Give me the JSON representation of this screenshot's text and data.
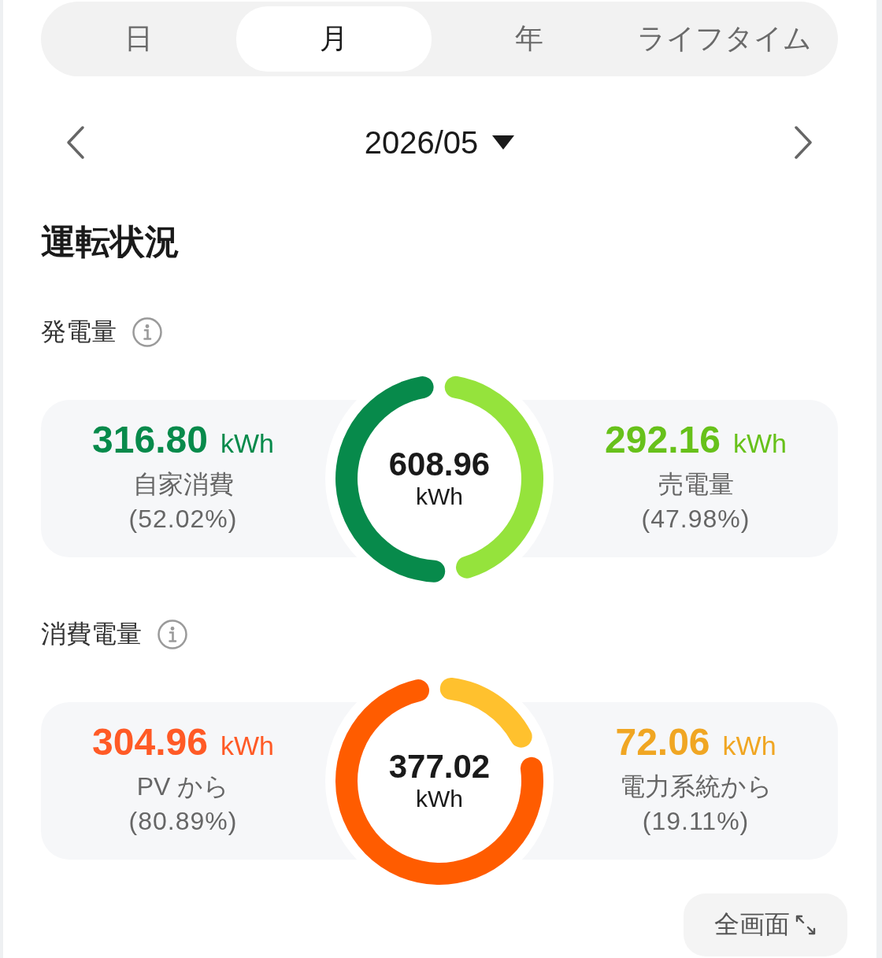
{
  "tabs": [
    {
      "label": "日",
      "selected": false
    },
    {
      "label": "月",
      "selected": true
    },
    {
      "label": "年",
      "selected": false
    },
    {
      "label": "ライフタイム",
      "selected": false
    }
  ],
  "period": {
    "label": "2026/05"
  },
  "section_title": "運転状況",
  "panels": [
    {
      "title": "発電量",
      "total": {
        "value": "608.96",
        "unit": "kWh"
      },
      "items": [
        {
          "value": "316.80",
          "unit": "kWh",
          "label": "自家消費",
          "share": "(52.02%)",
          "color": "#078a4b"
        },
        {
          "value": "292.16",
          "unit": "kWh",
          "label": "売電量",
          "share": "(47.98%)",
          "color": "#67c11a"
        }
      ],
      "chart_data": {
        "type": "donut",
        "values": [
          52.02,
          47.98
        ],
        "colors": [
          "#078a4b",
          "#95e33c"
        ]
      }
    },
    {
      "title": "消費電量",
      "total": {
        "value": "377.02",
        "unit": "kWh"
      },
      "items": [
        {
          "value": "304.96",
          "unit": "kWh",
          "label": "PV から",
          "share": "(80.89%)",
          "color": "#ff5a26"
        },
        {
          "value": "72.06",
          "unit": "kWh",
          "label": "電力系統から",
          "share": "(19.11%)",
          "color": "#f0a623"
        }
      ],
      "chart_data": {
        "type": "donut",
        "values": [
          80.89,
          19.11
        ],
        "colors": [
          "#ff5c00",
          "#ffc12e"
        ]
      }
    }
  ],
  "fullscreen_button": {
    "label": "全画面"
  }
}
